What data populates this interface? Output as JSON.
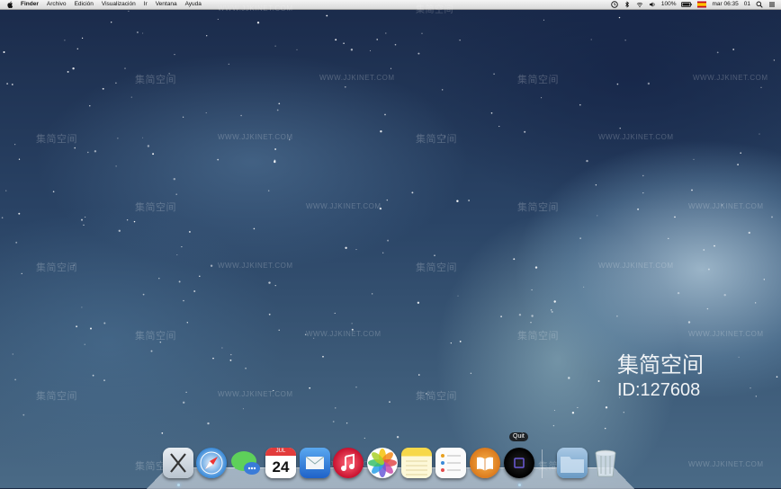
{
  "menubar": {
    "app_name": "Finder",
    "items": [
      "Archivo",
      "Edición",
      "Visualización",
      "Ir",
      "Ventana",
      "Ayuda"
    ],
    "battery": "100%",
    "clock": "mar 06:35",
    "user": "01"
  },
  "dock": {
    "tooltip": "Quit",
    "calendar_day": "24",
    "calendar_month": "JUL",
    "apps": [
      "x-icon",
      "safari-icon",
      "messages-icon",
      "calendar-icon",
      "mail-icon",
      "itunes-icon",
      "photos-icon",
      "notes-icon",
      "reminders-icon",
      "ibooks-icon",
      "quit-app-icon",
      "folder-icon",
      "trash-icon"
    ]
  },
  "watermark": {
    "brand": "集简空间",
    "site": "WWW.JJKINET.COM",
    "id": "ID:127608"
  },
  "colors": {
    "menubar": "#e8e8e8",
    "sky_dark": "#1a2a4a",
    "sky_light": "#4a6a86"
  }
}
